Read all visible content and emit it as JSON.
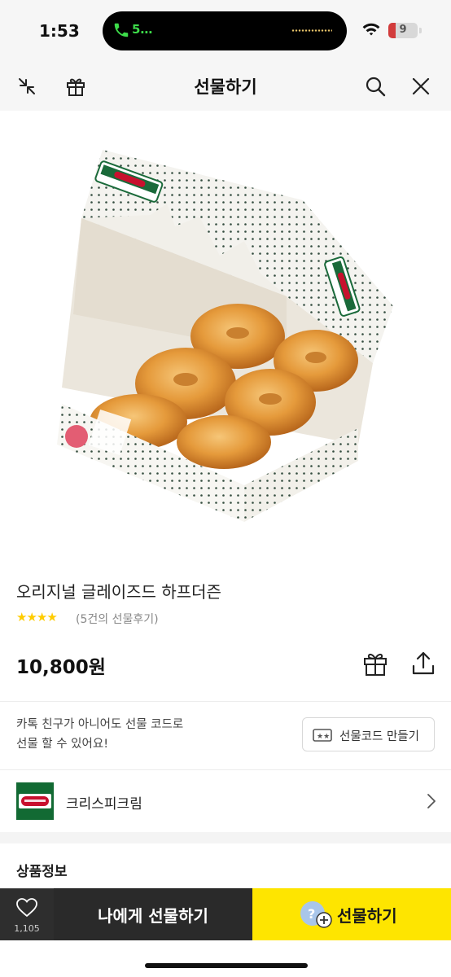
{
  "status_bar": {
    "time": "1:53",
    "call_indicator": "5…",
    "battery_level": "9",
    "icons": [
      "phone-icon",
      "wifi-icon",
      "battery-icon"
    ],
    "colors": {
      "call": "#3ddc4a",
      "battery_low": "#d23b3b"
    }
  },
  "header": {
    "title": "선물하기",
    "icons": [
      "collapse-arrows-icon",
      "gift-icon",
      "search-icon",
      "close-icon"
    ]
  },
  "product": {
    "image_icon": "donut-box-image",
    "name": "오리지널 글레이즈드 하프더즌",
    "rating_stars": "★★★★",
    "rating_value": 4,
    "review_text": "(5건의 선물후기)",
    "price": "10,800원",
    "actions": [
      "gift-box-icon",
      "share-icon"
    ]
  },
  "gift_code": {
    "line1": "카톡 친구가 아니어도 선물 코드로",
    "line2": "선물 할 수 있어요!",
    "button_label": "선물코드 만들기",
    "button_icon": "ticket-icon"
  },
  "brand": {
    "name": "크리스피크림",
    "logo_icon": "krispy-kreme-logo",
    "logo_color": "#126a33"
  },
  "sections": {
    "product_info_title": "상품정보"
  },
  "bottom_bar": {
    "like_count": "1,105",
    "self_gift_label": "나에게 선물하기",
    "gift_label": "선물하기",
    "colors": {
      "gift_button": "#fee500",
      "dark": "#2a2a2a"
    }
  }
}
